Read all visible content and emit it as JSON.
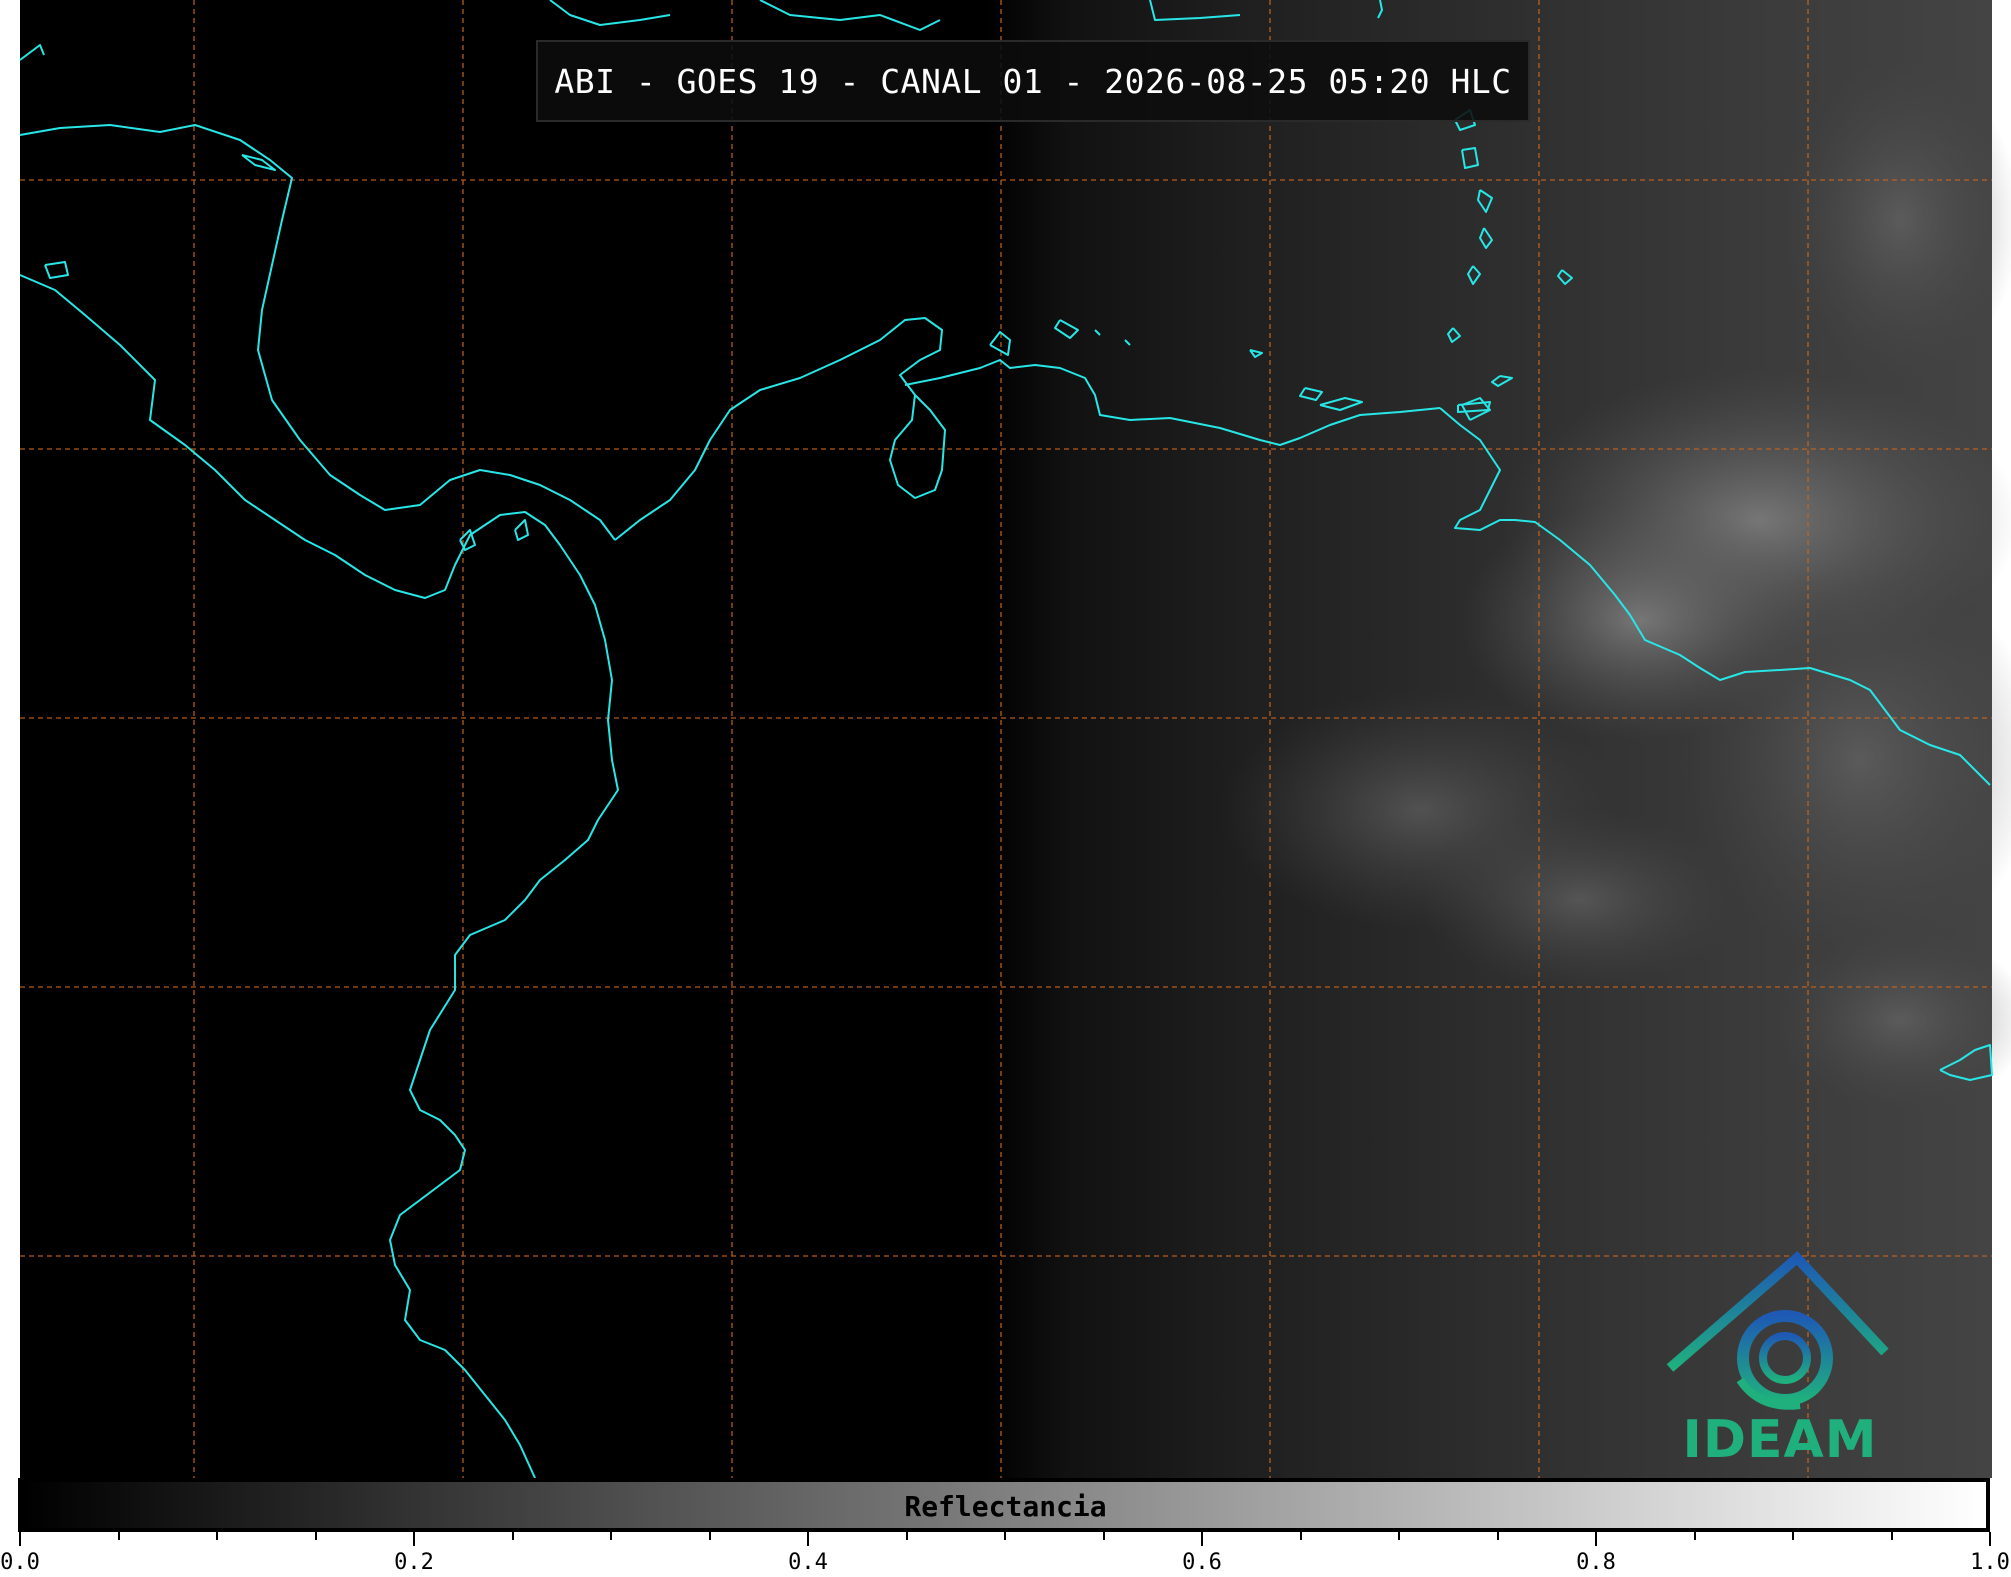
{
  "map": {
    "title": "ABI - GOES 19 - CANAL 01 - 2026-08-25 05:20 HLC",
    "background_color": "#000000",
    "coastline_color": "#28e6e6",
    "gridline_color": "#c8641e",
    "logo_icon": "ideam-logo",
    "logo_text": "IDEAM",
    "logo_colors": [
      "#1e5ab4",
      "#1fb07e"
    ]
  },
  "colorbar": {
    "label": "Reflectancia",
    "range": [
      0.0,
      1.0
    ],
    "tick_labels": [
      "0.0",
      "0.2",
      "0.4",
      "0.6",
      "0.8",
      "1.0"
    ],
    "colormap": [
      "#000000",
      "#ffffff"
    ]
  }
}
